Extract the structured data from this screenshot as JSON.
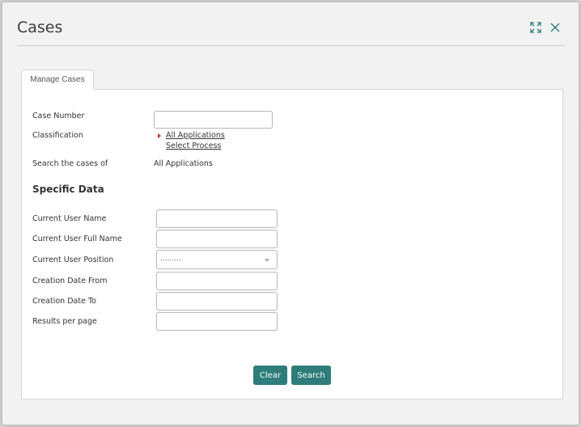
{
  "dialog": {
    "title": "Cases",
    "maximize_icon": "maximize-icon",
    "close_icon": "close-icon"
  },
  "tabs": [
    {
      "label": "Manage Cases"
    }
  ],
  "form": {
    "case_number": {
      "label": "Case Number",
      "value": ""
    },
    "classification": {
      "label": "Classification",
      "all_applications_link": "All Applications",
      "select_process_link": "Select Process"
    },
    "search_cases_of": {
      "label": "Search the cases of",
      "value": "All Applications"
    }
  },
  "specific_data": {
    "title": "Specific Data",
    "current_user_name": {
      "label": "Current User Name",
      "value": ""
    },
    "current_user_full_name": {
      "label": "Current User Full Name",
      "value": ""
    },
    "current_user_position": {
      "label": "Current User Position",
      "selected": "........."
    },
    "creation_date_from": {
      "label": "Creation Date From",
      "value": ""
    },
    "creation_date_to": {
      "label": "Creation Date To",
      "value": ""
    },
    "results_per_page": {
      "label": "Results per page",
      "value": ""
    }
  },
  "buttons": {
    "clear": "Clear",
    "search": "Search"
  },
  "colors": {
    "accent": "#2e7d7a",
    "link_arrow": "#c0392b"
  }
}
